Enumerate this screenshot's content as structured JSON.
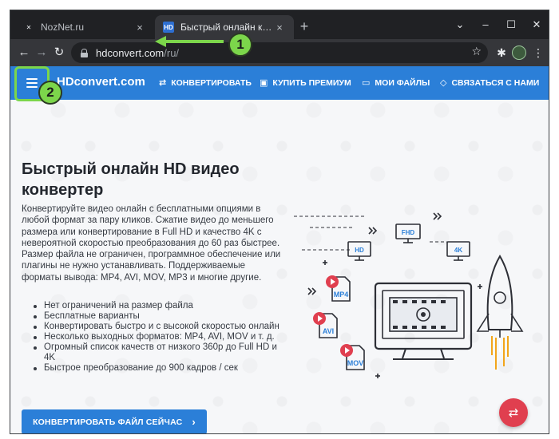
{
  "browser": {
    "tabs": [
      {
        "title": "NozNet.ru",
        "favicon": "nz",
        "active": false
      },
      {
        "title": "Быстрый онлайн конвертер вид",
        "favicon": "HD",
        "active": true
      }
    ],
    "address": {
      "host": "hdconvert.com",
      "path": "/ru/"
    }
  },
  "site": {
    "brand": "HDconvert.com",
    "nav": [
      {
        "label": "КОНВЕРТИРОВАТЬ",
        "icon": "swap-icon"
      },
      {
        "label": "КУПИТЬ ПРЕМИУМ",
        "icon": "bag-icon"
      },
      {
        "label": "МОИ ФАЙЛЫ",
        "icon": "folder-icon"
      },
      {
        "label": "СВЯЗАТЬСЯ С НАМИ",
        "icon": "diamond-icon"
      }
    ]
  },
  "hero": {
    "title": "Быстрый онлайн HD видео конвертер",
    "description": "Конвертируйте видео онлайн с бесплатными опциями в любой формат за пару кликов. Сжатие видео до меньшего размера или конвертирование в Full HD и качество 4K с невероятной скоростью преобразования до 60 раз быстрее. Размер файла не ограничен, программное обеспечение или плагины не нужно устанавливать. Поддерживаемые форматы вывода: MP4, AVI, MOV, MP3 и многие другие.",
    "features": [
      "Нет ограничений на размер файла",
      "Бесплатные варианты",
      "Конвертировать быстро и с высокой скоростью онлайн",
      "Несколько выходных форматов: MP4, AVI, MOV и т. д.",
      "Огромный список качеств от низкого 360p до Full HD и 4K",
      "Быстрое преобразование до 900 кадров / сек"
    ],
    "cta": "КОНВЕРТИРОВАТЬ ФАЙЛ СЕЙЧАС"
  },
  "illustration": {
    "labels": [
      "HD",
      "FHD",
      "4K",
      "MP4",
      "AVI",
      "MOV"
    ]
  },
  "annotations": {
    "badge1": "1",
    "badge2": "2",
    "color": "#7cd64b"
  },
  "colors": {
    "site_blue": "#2b7fd8",
    "fab_red": "#e03f4f"
  }
}
